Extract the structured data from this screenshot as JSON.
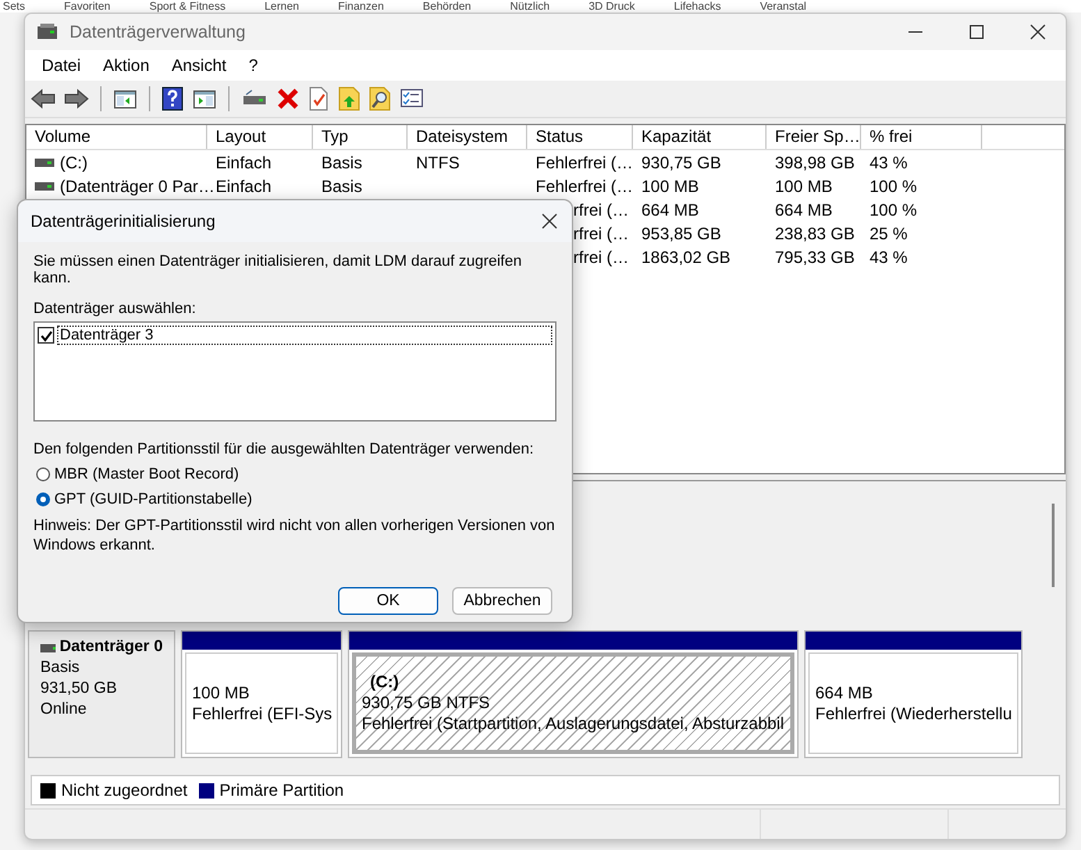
{
  "bookmarks_bar": {
    "items": [
      "Sets",
      "Favoriten",
      "Sport & Fitness",
      "Lernen",
      "Finanzen",
      "Behörden",
      "Nützlich",
      "3D Druck",
      "Lifehacks",
      "Veranstal"
    ]
  },
  "window": {
    "title": "Datenträgerverwaltung"
  },
  "menu": [
    "Datei",
    "Aktion",
    "Ansicht",
    "?"
  ],
  "volume_table": {
    "columns": [
      "Volume",
      "Layout",
      "Typ",
      "Dateisystem",
      "Status",
      "Kapazität",
      "Freier Sp…",
      "% frei"
    ],
    "rows": [
      {
        "volume": "(C:)",
        "layout": "Einfach",
        "typ": "Basis",
        "dateisystem": "NTFS",
        "status": "Fehlerfrei (…",
        "kapazitaet": "930,75 GB",
        "frei": "398,98 GB",
        "prozent": "43 %"
      },
      {
        "volume": "(Datenträger 0 Par…",
        "layout": "Einfach",
        "typ": "Basis",
        "status": "Fehlerfrei (…",
        "kapazitaet": "100 MB",
        "frei": "100 MB",
        "prozent": "100 %"
      },
      {
        "status": "rfrei (…",
        "kapazitaet": "664 MB",
        "frei": "664 MB",
        "prozent": "100 %"
      },
      {
        "status": "rfrei (…",
        "kapazitaet": "953,85 GB",
        "frei": "238,83 GB",
        "prozent": "25 %"
      },
      {
        "status": "rfrei (…",
        "kapazitaet": "1863,02 GB",
        "frei": "795,33 GB",
        "prozent": "43 %"
      }
    ]
  },
  "disks": [
    {
      "name": "Datenträger 0",
      "type": "Basis",
      "size": "931,50 GB",
      "status": "Online",
      "partitions": [
        {
          "size": "100 MB",
          "status": "Fehlerfrei (EFI-Sys",
          "selected": false
        },
        {
          "label": "(C:)",
          "size": "930,75 GB NTFS",
          "status": "Fehlerfrei (Startpartition, Auslagerungsdatei, Absturzabbil",
          "selected": true
        },
        {
          "size": "664 MB",
          "status": "Fehlerfrei (Wiederherstellu",
          "selected": false
        }
      ]
    }
  ],
  "legend": [
    {
      "label": "Nicht zugeordnet",
      "color": "#000000"
    },
    {
      "label": "Primäre Partition",
      "color": "#000080"
    }
  ],
  "dialog": {
    "title": "Datenträgerinitialisierung",
    "intro": "Sie müssen einen Datenträger initialisieren, damit LDM darauf zugreifen kann.",
    "select_label": "Datenträger auswählen:",
    "disks": [
      {
        "label": "Datenträger 3",
        "checked": true
      }
    ],
    "style_label": "Den folgenden Partitionsstil für die ausgewählten Datenträger verwenden:",
    "partition_styles": [
      {
        "label": "MBR (Master Boot Record)",
        "selected": false
      },
      {
        "label": "GPT (GUID-Partitionstabelle)",
        "selected": true
      }
    ],
    "note": "Hinweis: Der GPT-Partitionsstil wird nicht von allen vorherigen Versionen von Windows erkannt.",
    "buttons": [
      {
        "label": "OK",
        "default": true
      },
      {
        "label": "Abbrechen",
        "default": false
      }
    ]
  }
}
